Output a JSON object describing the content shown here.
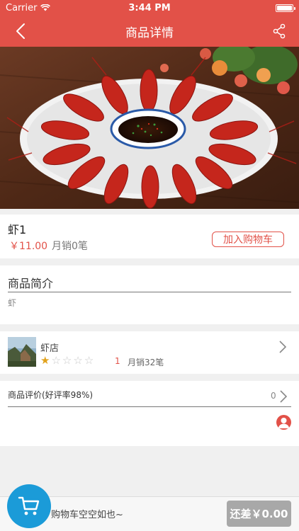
{
  "status_bar": {
    "carrier": "Carrier",
    "time": "3:44 PM",
    "wifi_icon": "wifi-icon",
    "battery_icon": "battery-icon"
  },
  "nav": {
    "title": "商品详情",
    "back_icon": "back-chevron-icon",
    "share_icon": "share-icon"
  },
  "product": {
    "name": "虾1",
    "price": "￥11.00",
    "monthly_sales": "月销0笔",
    "add_to_cart": "加入购物车"
  },
  "intro": {
    "title": "商品简介",
    "text": "虾"
  },
  "shop": {
    "name": "虾店",
    "rating_value": 1,
    "rating_max": 5,
    "rating_text": "1",
    "monthly_sales": "月销32笔"
  },
  "reviews": {
    "title": "商品评价(好评率98%)",
    "count": "0"
  },
  "cart": {
    "empty_text": "购物车空空如也~",
    "checkout": "还差￥0.00",
    "cart_icon": "shopping-cart-icon"
  },
  "colors": {
    "accent": "#e25148",
    "cart_blue": "#1b9bd8",
    "star": "#e1a21c",
    "checkout_disabled": "#a8a8a8"
  }
}
